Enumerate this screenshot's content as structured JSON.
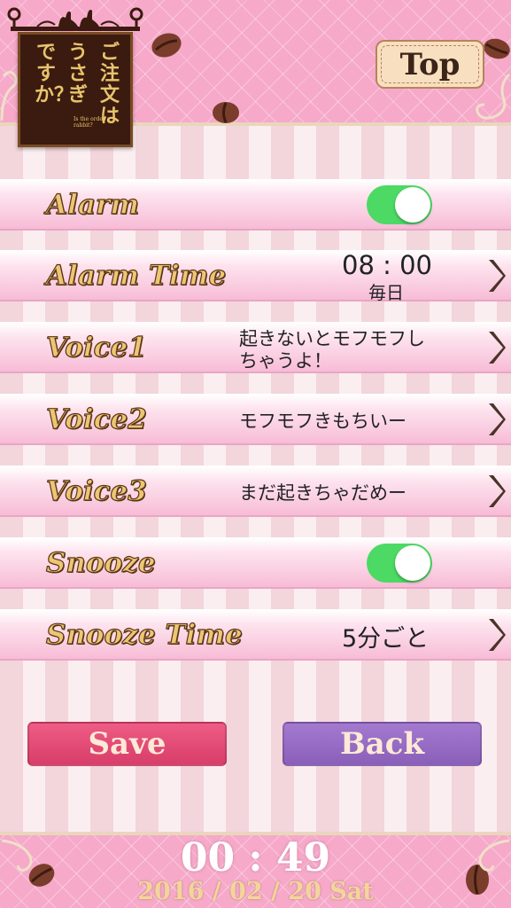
{
  "header": {
    "logo": {
      "title_columns": [
        "ご注文は",
        "うさぎ",
        "ですか？"
      ],
      "subtitle": "Is the order a rabbit?"
    },
    "top_button_label": "Top"
  },
  "settings": {
    "alarm": {
      "label": "Alarm",
      "enabled": true
    },
    "alarm_time": {
      "label": "Alarm Time",
      "time": "08 : 00",
      "repeat": "毎日"
    },
    "voice1": {
      "label": "Voice1",
      "line1": "起きないとモフモフし",
      "line2": "ちゃうよ！"
    },
    "voice2": {
      "label": "Voice2",
      "value": "モフモフきもちいー"
    },
    "voice3": {
      "label": "Voice3",
      "value": "まだ起きちゃだめー"
    },
    "snooze": {
      "label": "Snooze",
      "enabled": true
    },
    "snooze_time": {
      "label": "Snooze Time",
      "value": "5分ごと"
    }
  },
  "actions": {
    "save_label": "Save",
    "back_label": "Back"
  },
  "footer": {
    "clock": "00 : 49",
    "date": "2016 / 02 / 20  Sat"
  },
  "colors": {
    "toggle_on": "#4cd964",
    "save_button": "#e24a74",
    "back_button": "#9168c0",
    "label_gold": "#ecc673"
  },
  "icons": [
    "chevron-right-icon",
    "coffee-bean-icon",
    "rabbit-icon"
  ]
}
